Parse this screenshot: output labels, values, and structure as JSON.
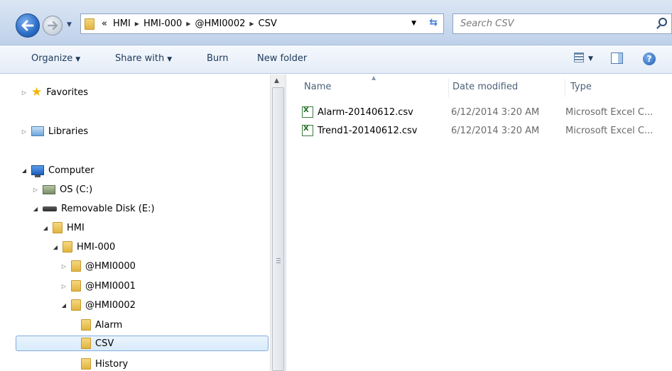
{
  "address_bar": {
    "overflow": "«",
    "crumbs": [
      "HMI",
      "HMI-000",
      "@HMI0002",
      "CSV"
    ]
  },
  "search": {
    "placeholder": "Search CSV"
  },
  "toolbar": {
    "organize": "Organize",
    "share_with": "Share with",
    "burn": "Burn",
    "new_folder": "New folder",
    "help": "?"
  },
  "nav_tree": {
    "favorites": "Favorites",
    "libraries": "Libraries",
    "computer": "Computer",
    "os_drive": "OS (C:)",
    "removable": "Removable Disk (E:)",
    "hmi": "HMI",
    "hmi000": "HMI-000",
    "hmi0000": "@HMI0000",
    "hmi0001": "@HMI0001",
    "hmi0002": "@HMI0002",
    "alarm": "Alarm",
    "csv": "CSV",
    "history": "History"
  },
  "columns": {
    "name": "Name",
    "date": "Date modified",
    "type": "Type"
  },
  "files": [
    {
      "name": "Alarm-20140612.csv",
      "date": "6/12/2014 3:20 AM",
      "type": "Microsoft Excel C..."
    },
    {
      "name": "Trend1-20140612.csv",
      "date": "6/12/2014 3:20 AM",
      "type": "Microsoft Excel C..."
    }
  ]
}
